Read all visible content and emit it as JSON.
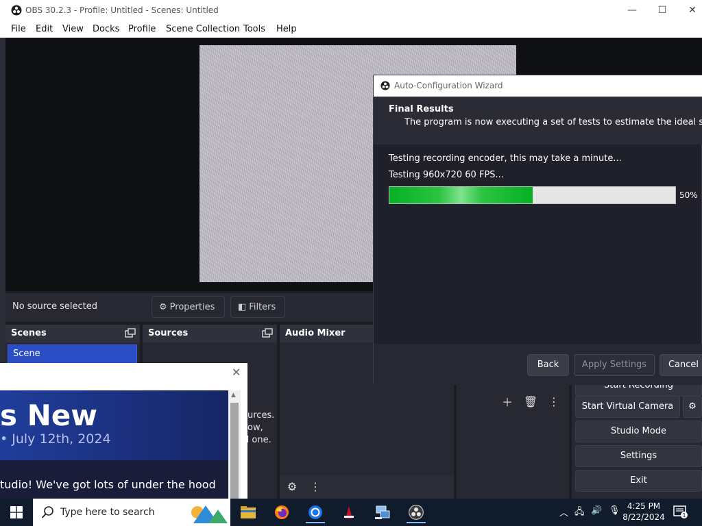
{
  "window": {
    "title": "OBS 30.2.3 - Profile: Untitled - Scenes: Untitled",
    "minimize": "—",
    "maximize": "☐",
    "close": "✕"
  },
  "menu": [
    "File",
    "Edit",
    "View",
    "Docks",
    "Profile",
    "Scene Collection",
    "Tools",
    "Help"
  ],
  "source_toolbar": {
    "no_source": "No source selected",
    "properties": "Properties",
    "filters": "Filters"
  },
  "docks": {
    "scenes": {
      "title": "Scenes",
      "items": [
        "Scene"
      ]
    },
    "sources": {
      "title": "Sources",
      "partial_lines": [
        "urces.",
        "ow,",
        "d one."
      ]
    },
    "audio_mixer": {
      "title": "Audio Mixer"
    }
  },
  "controls": {
    "start_recording_partial": "Start Recording",
    "start_virtual_camera": "Start Virtual Camera",
    "studio_mode": "Studio Mode",
    "settings": "Settings",
    "exit": "Exit"
  },
  "whats_new": {
    "heading": "s New",
    "date": "• July 12th, 2024",
    "body": "tudio! We've got lots of under the hood",
    "close": "✕"
  },
  "wizard": {
    "title": "Auto-Configuration Wizard",
    "header_title": "Final Results",
    "header_subtitle": "The program is now executing a set of tests to estimate the ideal settings",
    "status_line1": "Testing recording encoder, this may take a minute...",
    "status_line2": "Testing 960x720 60 FPS...",
    "progress": 50,
    "progress_label": "50%",
    "buttons": {
      "back": "Back",
      "apply": "Apply Settings",
      "cancel": "Cancel"
    }
  },
  "taskbar": {
    "search_placeholder": "Type here to search",
    "apps": [
      "file-explorer",
      "firefox",
      "chrome",
      "filezilla",
      "network-tool",
      "obs-studio"
    ],
    "time": "4:25 PM",
    "date": "8/22/2024",
    "notification_count": "1"
  },
  "colors": {
    "accent": "#2b4ec4",
    "progress_green": "#06b025",
    "dock_bg": "#272832",
    "taskbar_bg": "#101c2c"
  }
}
